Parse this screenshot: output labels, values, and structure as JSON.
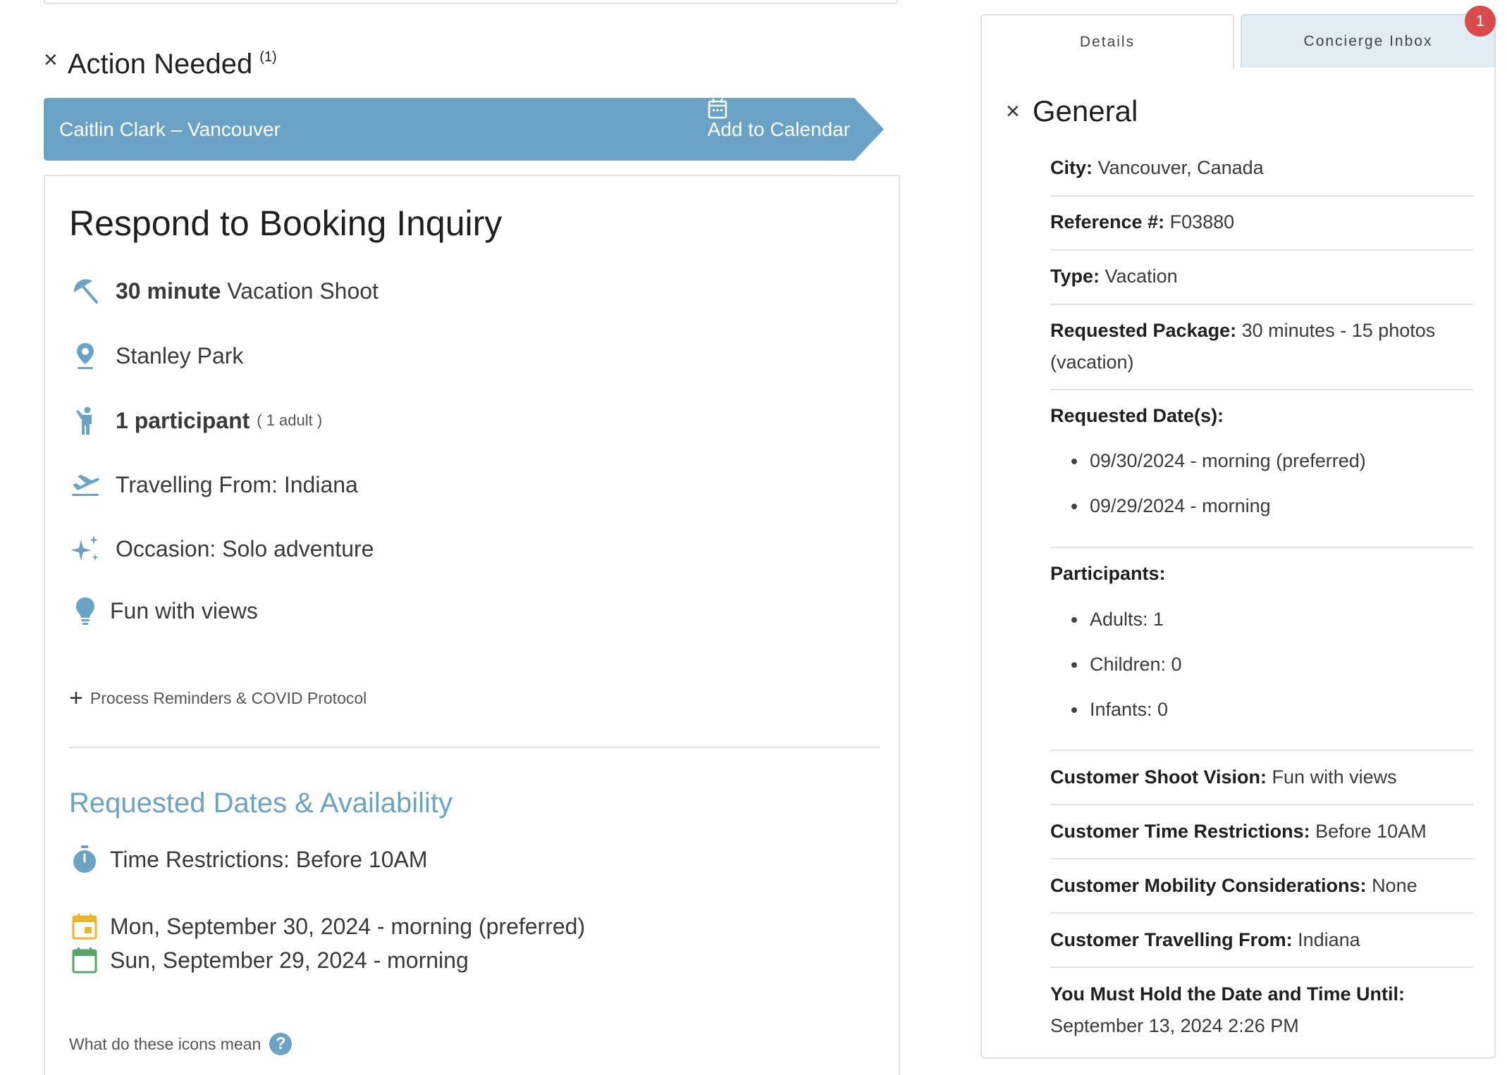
{
  "action": {
    "title": "Action Needed",
    "count": "(1)"
  },
  "ribbon": {
    "name": "Caitlin Clark – Vancouver",
    "calendar_label": "Add to Calendar"
  },
  "card": {
    "title": "Respond to Booking Inquiry",
    "shoot_bold": "30 minute",
    "shoot_rest": " Vacation Shoot",
    "location": "Stanley Park",
    "participants_bold": "1 participant",
    "participants_sub": "( 1 adult )",
    "travelling": "Travelling From: Indiana",
    "occasion": "Occasion: Solo adventure",
    "vision": "Fun with views",
    "reminders": "Process Reminders & COVID Protocol",
    "section_title": "Requested Dates & Availability",
    "time_restrictions": "Time Restrictions: Before 10AM",
    "dates": [
      "Mon, September 30, 2024 - morning (preferred)",
      "Sun, September 29, 2024 - morning"
    ],
    "help": "What do these icons mean"
  },
  "tabs": {
    "details": "Details",
    "inbox": "Concierge Inbox",
    "inbox_badge": "1"
  },
  "general": {
    "title": "General",
    "city_label": "City:",
    "city": "Vancouver, Canada",
    "ref_label": "Reference #:",
    "ref": "F03880",
    "type_label": "Type:",
    "type": "Vacation",
    "package_label": "Requested Package:",
    "package": "30 minutes - 15 photos (vacation)",
    "dates_label": "Requested Date(s):",
    "dates": [
      "09/30/2024 - morning (preferred)",
      "09/29/2024 - morning"
    ],
    "participants_label": "Participants:",
    "participants": [
      "Adults: 1",
      "Children: 0",
      "Infants: 0"
    ],
    "vision_label": "Customer Shoot Vision:",
    "vision": "Fun with views",
    "time_label": "Customer Time Restrictions:",
    "time": "Before 10AM",
    "mobility_label": "Customer Mobility Considerations:",
    "mobility": "None",
    "travel_label": "Customer Travelling From:",
    "travel": "Indiana",
    "hold_label": "You Must Hold the Date and Time Until:",
    "hold": "September 13, 2024 2:26 PM"
  },
  "colors": {
    "accent": "#6aa3c6",
    "badge": "#d94b4b",
    "date_preferred": "#e8b730",
    "date_alt": "#5aa469"
  }
}
